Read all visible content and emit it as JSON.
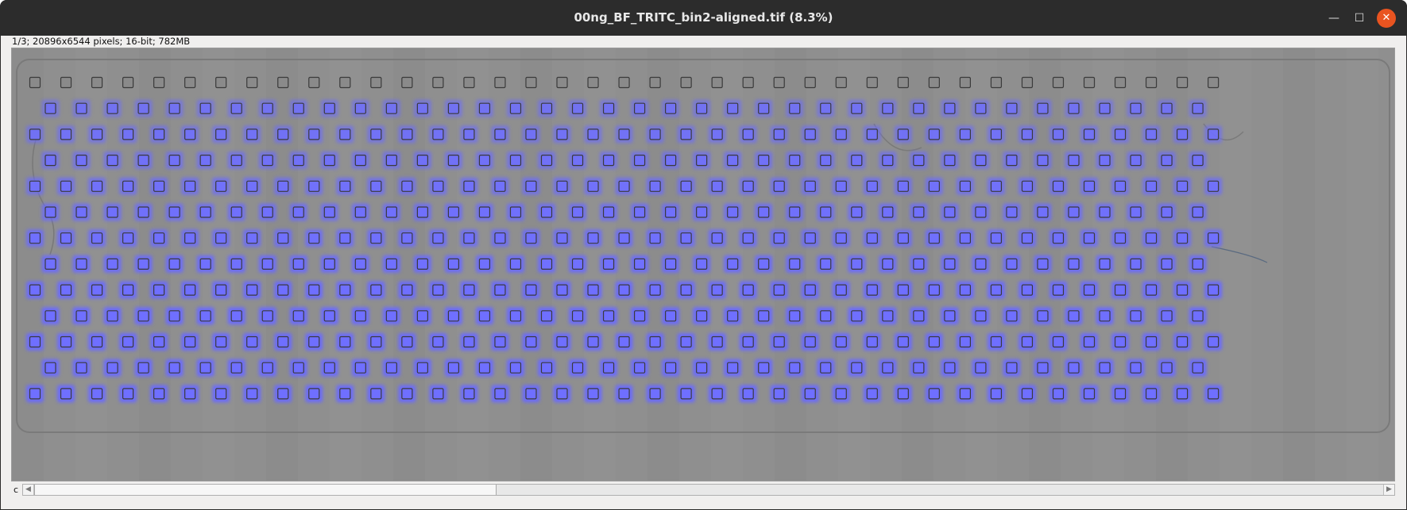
{
  "window": {
    "title": "00ng_BF_TRITC_bin2-aligned.tif (8.3%)",
    "minimize_icon": "minimize-icon",
    "maximize_icon": "maximize-icon",
    "close_icon": "close-icon",
    "close_color": "#e95420"
  },
  "image_info": "1/3; 20896x6544 pixels; 16-bit; 782MB",
  "image": {
    "description_colors": {
      "background": "#8e8e8e",
      "overlay": "#6a6aff",
      "well_outline": "#3a3a3a"
    },
    "grid_rows": 13,
    "grid_columns": 39
  },
  "slider": {
    "channel_label": "c",
    "left_arrow_icon": "arrow-left-icon",
    "right_arrow_icon": "arrow-right-icon",
    "position_fraction": 0.0
  }
}
